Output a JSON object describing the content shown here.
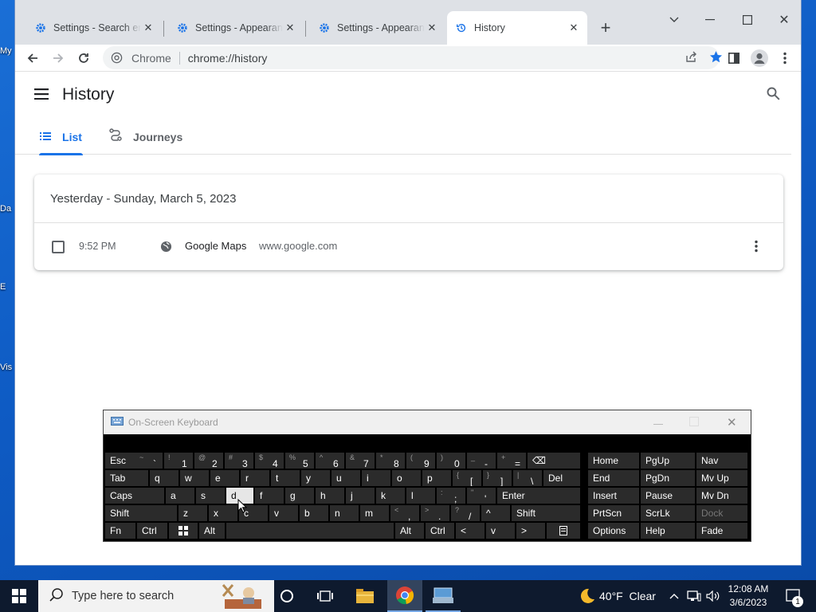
{
  "desktop": {
    "icons": [
      "My",
      "Da",
      "E",
      "Vis"
    ]
  },
  "browser": {
    "tabs": [
      {
        "label": "Settings - Search engine",
        "icon": "gear-icon",
        "active": false
      },
      {
        "label": "Settings - Appearance",
        "icon": "gear-icon",
        "active": false
      },
      {
        "label": "Settings - Appearance",
        "icon": "gear-icon",
        "active": false
      },
      {
        "label": "History",
        "icon": "history-icon",
        "active": true
      }
    ],
    "omnibox": {
      "site_label": "Chrome",
      "url": "chrome://history"
    },
    "accent_color": "#1a73e8"
  },
  "history": {
    "title": "History",
    "tabs": [
      {
        "label": "List",
        "icon": "list-icon",
        "active": true
      },
      {
        "label": "Journeys",
        "icon": "journeys-icon",
        "active": false
      }
    ],
    "groups": [
      {
        "date": "Yesterday - Sunday, March 5, 2023",
        "entries": [
          {
            "time": "9:52 PM",
            "title": "Google Maps",
            "domain": "www.google.com"
          }
        ]
      }
    ]
  },
  "osk": {
    "title": "On-Screen Keyboard",
    "rows": [
      [
        {
          "main": "Esc"
        },
        {
          "shift": "~",
          "main": "`"
        },
        {
          "shift": "!",
          "main": "1"
        },
        {
          "shift": "@",
          "main": "2"
        },
        {
          "shift": "#",
          "main": "3"
        },
        {
          "shift": "$",
          "main": "4"
        },
        {
          "shift": "%",
          "main": "5"
        },
        {
          "shift": "^",
          "main": "6"
        },
        {
          "shift": "&",
          "main": "7"
        },
        {
          "shift": "*",
          "main": "8"
        },
        {
          "shift": "(",
          "main": "9"
        },
        {
          "shift": ")",
          "main": "0"
        },
        {
          "shift": "_",
          "main": "-"
        },
        {
          "shift": "+",
          "main": "="
        },
        {
          "main": "⌫"
        }
      ],
      [
        {
          "main": "Tab"
        },
        {
          "main": "q"
        },
        {
          "main": "w"
        },
        {
          "main": "e"
        },
        {
          "main": "r"
        },
        {
          "main": "t"
        },
        {
          "main": "y"
        },
        {
          "main": "u"
        },
        {
          "main": "i"
        },
        {
          "main": "o"
        },
        {
          "main": "p"
        },
        {
          "shift": "{",
          "main": "["
        },
        {
          "shift": "}",
          "main": "]"
        },
        {
          "shift": "|",
          "main": "\\"
        },
        {
          "main": "Del"
        }
      ],
      [
        {
          "main": "Caps"
        },
        {
          "main": "a"
        },
        {
          "main": "s"
        },
        {
          "main": "d"
        },
        {
          "main": "f"
        },
        {
          "main": "g"
        },
        {
          "main": "h"
        },
        {
          "main": "j"
        },
        {
          "main": "k"
        },
        {
          "main": "l"
        },
        {
          "shift": ":",
          "main": ";"
        },
        {
          "shift": "\"",
          "main": "'"
        },
        {
          "main": "Enter"
        }
      ],
      [
        {
          "main": "Shift"
        },
        {
          "main": "z"
        },
        {
          "main": "x"
        },
        {
          "main": "c"
        },
        {
          "main": "v"
        },
        {
          "main": "b"
        },
        {
          "main": "n"
        },
        {
          "main": "m"
        },
        {
          "shift": "<",
          "main": ","
        },
        {
          "shift": ">",
          "main": "."
        },
        {
          "shift": "?",
          "main": "/"
        },
        {
          "main": "^"
        },
        {
          "main": "Shift"
        }
      ],
      [
        {
          "main": "Fn"
        },
        {
          "main": "Ctrl"
        },
        {
          "main": "win"
        },
        {
          "main": "Alt"
        },
        {
          "main": ""
        },
        {
          "main": "Alt"
        },
        {
          "main": "Ctrl"
        },
        {
          "main": "<"
        },
        {
          "main": "v"
        },
        {
          "main": ">"
        },
        {
          "main": "menu"
        }
      ]
    ],
    "nav": [
      [
        "Home",
        "PgUp",
        "Nav"
      ],
      [
        "End",
        "PgDn",
        "Mv Up"
      ],
      [
        "Insert",
        "Pause",
        "Mv Dn"
      ],
      [
        "PrtScn",
        "ScrLk",
        "Dock"
      ],
      [
        "Options",
        "Help",
        "Fade"
      ]
    ],
    "highlighted_key": "d"
  },
  "taskbar": {
    "search_placeholder": "Type here to search",
    "weather": "40°F  Clear",
    "time": "12:08 AM",
    "date": "3/6/2023",
    "notification_count": "1"
  }
}
